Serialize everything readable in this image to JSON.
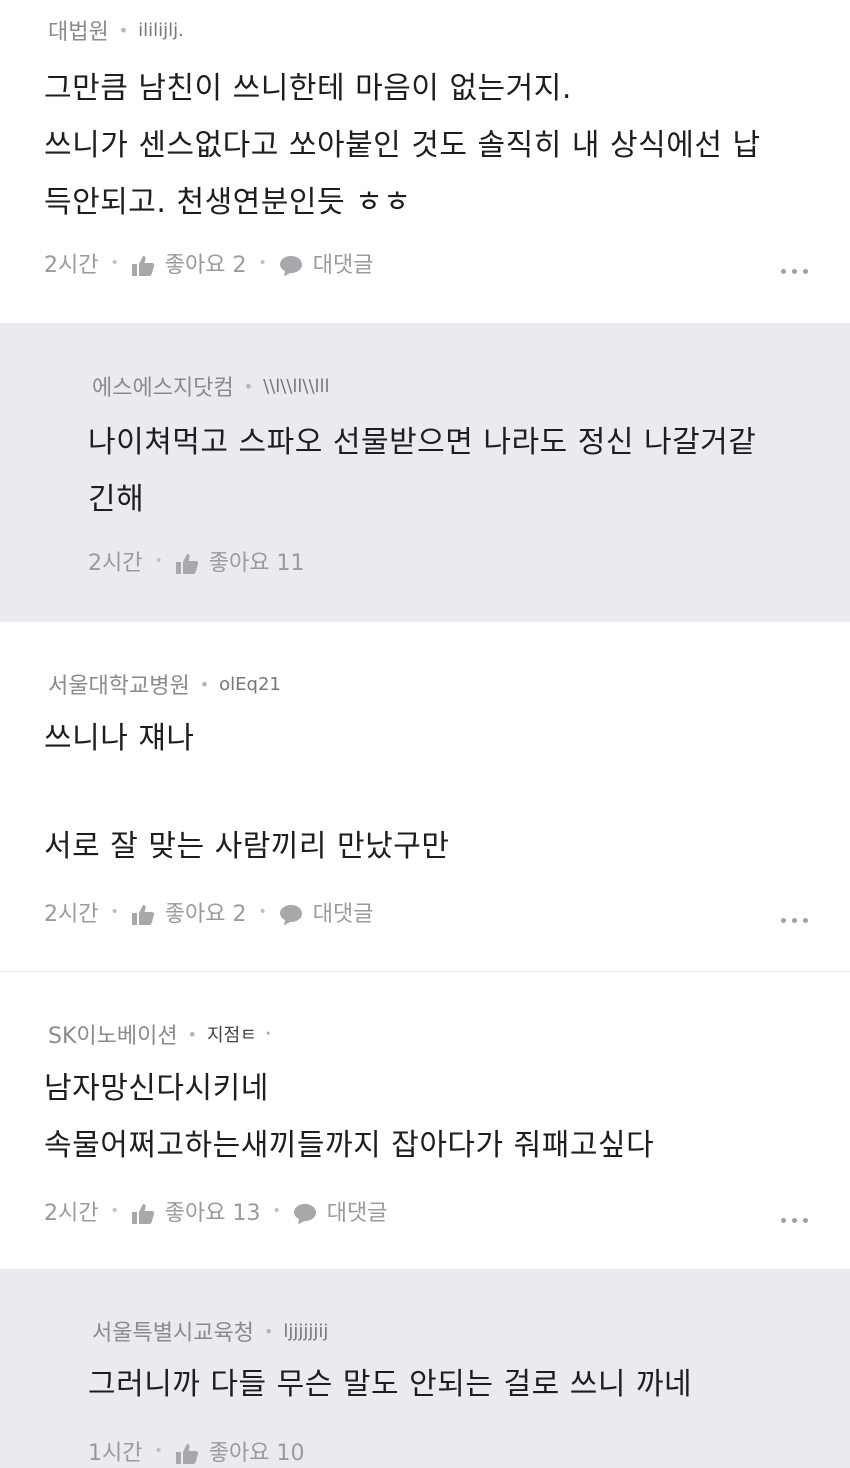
{
  "comments": [
    {
      "author": "대법원",
      "user": "ililijlj.",
      "lines": [
        "그만큼 남친이 쓰니한테 마음이 없는거지.",
        "쓰니가 센스없다고 쏘아붙인 것도 솔직히 내 상식에선 납",
        "득안되고. 천생연분인듯 ㅎㅎ"
      ],
      "time": "2시간",
      "like_label": "좋아요 2",
      "reply_label": "대댓글"
    },
    {
      "author": "에스에스지닷컴",
      "user": "\\\\l\\\\ll\\\\lll",
      "lines": [
        "나이쳐먹고 스파오 선물받으면 나라도 정신 나갈거같",
        "긴해"
      ],
      "time": "2시간",
      "like_label": "좋아요 11"
    },
    {
      "author": "서울대학교병원",
      "user": "olEq21",
      "lines": [
        "쓰니나 쟤나",
        "서로 잘 맞는 사람끼리 만났구만"
      ],
      "time": "2시간",
      "like_label": "좋아요 2",
      "reply_label": "대댓글"
    },
    {
      "author": "SK이노베이션",
      "user": "지점ㅌ",
      "trail": "·",
      "lines": [
        "남자망신다시키네",
        "속물어쩌고하는새끼들까지 잡아다가 줘패고싶다"
      ],
      "time": "2시간",
      "like_label": "좋아요 13",
      "reply_label": "대댓글"
    },
    {
      "author": "서울특별시교육청",
      "user": "ljjjjjjij",
      "lines": [
        "그러니까 다들 무슨 말도 안되는 걸로 쓰니 까네"
      ],
      "time": "1시간",
      "like_label": "좋아요 10"
    }
  ],
  "colors": {
    "reply_background": "#ebebef",
    "text": "#1e1e1e",
    "meta": "#8a8a90"
  },
  "icons": [
    "thumbs-up-icon",
    "speech-bubble-icon",
    "more-options-icon"
  ]
}
